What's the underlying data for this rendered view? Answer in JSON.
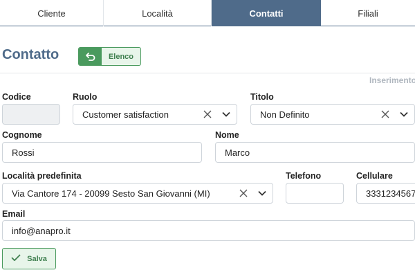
{
  "tabs": [
    {
      "label": "Cliente"
    },
    {
      "label": "Località"
    },
    {
      "label": "Contatti"
    },
    {
      "label": "Filiali"
    }
  ],
  "active_tab": "Contatti",
  "header": {
    "title": "Contatto",
    "elenco_label": "Elenco",
    "status_note": "Inserimento"
  },
  "form": {
    "codice": {
      "label": "Codice",
      "value": ""
    },
    "ruolo": {
      "label": "Ruolo",
      "value": "Customer satisfaction"
    },
    "titolo": {
      "label": "Titolo",
      "value": "Non Definito"
    },
    "cognome": {
      "label": "Cognome",
      "value": "Rossi"
    },
    "nome": {
      "label": "Nome",
      "value": "Marco"
    },
    "localita": {
      "label": "Località predefinita",
      "value": "Via Cantore 174 - 20099 Sesto San Giovanni (MI)"
    },
    "telefono": {
      "label": "Telefono",
      "value": ""
    },
    "cellulare": {
      "label": "Cellulare",
      "value": "3331234567"
    },
    "email": {
      "label": "Email",
      "value": "info@anapro.it"
    }
  },
  "actions": {
    "save_label": "Salva"
  },
  "colors": {
    "primary": "#4f6b8a",
    "success": "#4a9a5e"
  }
}
